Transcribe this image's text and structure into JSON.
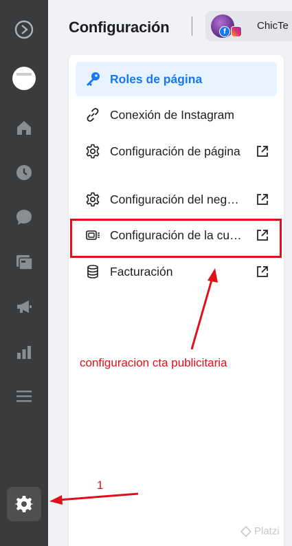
{
  "header": {
    "title": "Configuración",
    "account_name": "ChicTe"
  },
  "rail": {
    "items": [
      "meta-logo-icon",
      "page-avatar",
      "home-icon",
      "clock-icon",
      "chat-icon",
      "content-icon",
      "megaphone-icon",
      "insights-icon",
      "menu-icon",
      "settings-icon"
    ],
    "active": "settings-icon"
  },
  "menu": {
    "items": [
      {
        "label": "Roles de página",
        "icon": "key-icon",
        "active": true,
        "external": false
      },
      {
        "label": "Conexión de Instagram",
        "icon": "link-icon",
        "active": false,
        "external": false
      },
      {
        "label": "Configuración de página",
        "icon": "gear-icon",
        "active": false,
        "external": true
      },
      {
        "label": "Configuración del negocio",
        "icon": "gear-icon",
        "active": false,
        "external": true
      },
      {
        "label": "Configuración de la cuenta publicitaria",
        "icon": "ad-account-icon",
        "active": false,
        "external": true
      },
      {
        "label": "Facturación",
        "icon": "coins-icon",
        "active": false,
        "external": true
      }
    ]
  },
  "annotations": {
    "callout": "configuracion cta publicitaria",
    "step": "1",
    "color": "#e0101a"
  },
  "watermark": "Platzi",
  "colors": {
    "rail_bg": "#3a3b3c",
    "accent": "#1877f2",
    "active_bg": "#e7f3ff"
  }
}
